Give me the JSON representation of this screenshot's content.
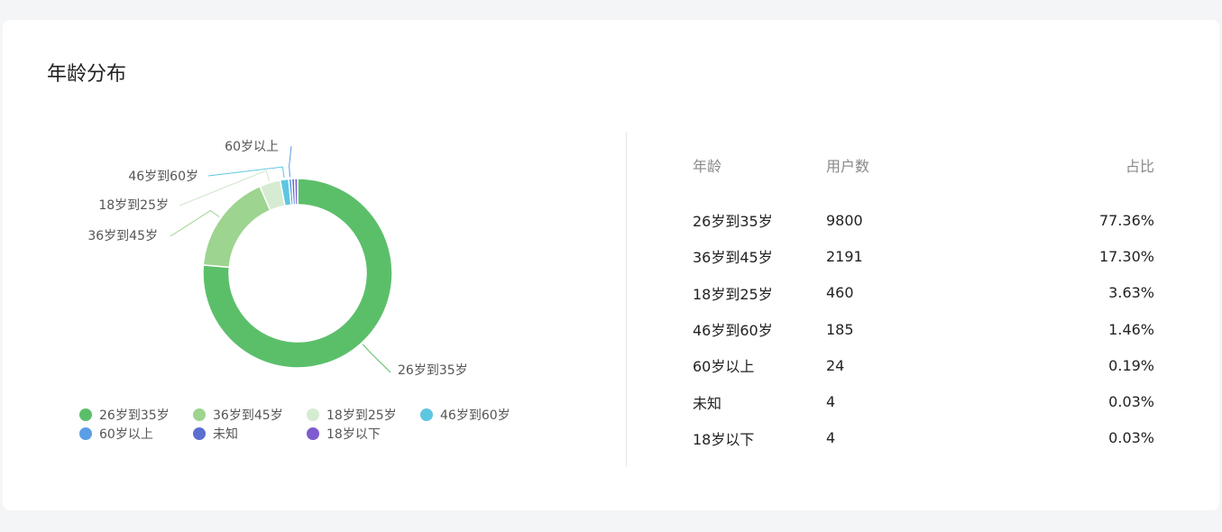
{
  "card": {
    "title": "年龄分布"
  },
  "chart_data": {
    "type": "pie",
    "variant": "donut",
    "categories": [
      "26岁到35岁",
      "36岁到45岁",
      "18岁到25岁",
      "46岁到60岁",
      "60岁以上",
      "未知",
      "18岁以下"
    ],
    "values": [
      9800,
      2191,
      460,
      185,
      24,
      4,
      4
    ],
    "colors": [
      "#5bbf6a",
      "#9dd48f",
      "#d6ecd2",
      "#5ec7e0",
      "#5b9ee6",
      "#5b6fd1",
      "#7e5bcf"
    ],
    "outside_labels": [
      "26岁到35岁",
      "36岁到45岁",
      "18岁到25岁",
      "46岁到60岁",
      "60岁以上"
    ],
    "legend_position": "bottom"
  },
  "table": {
    "headers": [
      "年龄",
      "用户数",
      "占比"
    ],
    "rows": [
      [
        "26岁到35岁",
        "9800",
        "77.36%"
      ],
      [
        "36岁到45岁",
        "2191",
        "17.30%"
      ],
      [
        "18岁到25岁",
        "460",
        "3.63%"
      ],
      [
        "46岁到60岁",
        "185",
        "1.46%"
      ],
      [
        "60岁以上",
        "24",
        "0.19%"
      ],
      [
        "未知",
        "4",
        "0.03%"
      ],
      [
        "18岁以下",
        "4",
        "0.03%"
      ]
    ]
  }
}
